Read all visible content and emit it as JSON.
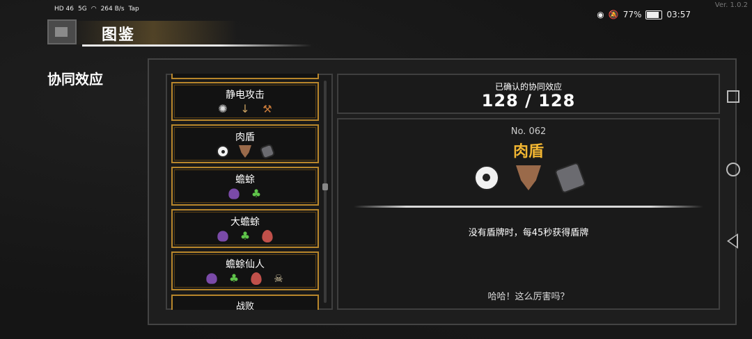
{
  "status_bar": {
    "net1": "HD 46",
    "net2": "5G",
    "speed": "264 B/s",
    "app": "Tap",
    "battery": "77%",
    "time": "03:57",
    "battery_level": 0.77
  },
  "version": "Ver. 1.0.2",
  "header": {
    "title": "图鉴"
  },
  "section": {
    "title": "协同效应"
  },
  "synergy_list": [
    {
      "name": "静电攻击",
      "icons": [
        "spark-icon",
        "arrow-icon",
        "hammer-icon"
      ]
    },
    {
      "name": "肉盾",
      "icons": [
        "ball-icon",
        "mask-icon",
        "stone-icon"
      ]
    },
    {
      "name": "蟾蜍",
      "icons": [
        "frog-icon",
        "clover-icon"
      ]
    },
    {
      "name": "大蟾蜍",
      "icons": [
        "frog-icon",
        "clover-icon",
        "egg-icon"
      ]
    },
    {
      "name": "蟾蜍仙人",
      "icons": [
        "frog-icon",
        "clover-icon",
        "egg-icon",
        "skull-icon"
      ]
    },
    {
      "name": "战败"
    }
  ],
  "count": {
    "label": "已确认的协同效应",
    "value": "128 / 128"
  },
  "detail": {
    "number": "No. 062",
    "name": "肉盾",
    "icons": [
      "ball-icon",
      "mask-icon",
      "stone-icon"
    ],
    "description": "没有盾牌时，每45秒获得盾牌",
    "quote": "哈哈！这么厉害吗？",
    "name_color": "#f2b632"
  },
  "accent_border": "#b8862b"
}
